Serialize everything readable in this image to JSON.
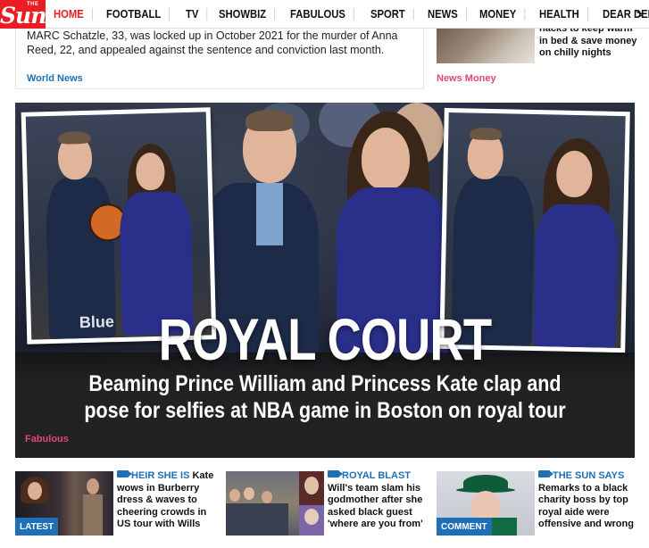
{
  "brand": {
    "logo_small": "THE",
    "logo_main": "Sun",
    "red": "#eb1c24",
    "blue": "#1e6fb5",
    "pink": "#e0457b"
  },
  "nav": {
    "items": [
      "HOME",
      "FOOTBALL",
      "TV",
      "SHOWBIZ",
      "FABULOUS",
      "SPORT",
      "NEWS",
      "MONEY",
      "HEALTH",
      "DEAR DEIRDRE"
    ],
    "active": "HOME",
    "more_icon": ">"
  },
  "top_left": {
    "text": "MARC Schatzle, 33, was locked up in October 2021 for the murder of Anna Reed, 22, and appealed against the sentence and conviction last month.",
    "category": "World News"
  },
  "top_right": {
    "text": "hacks to keep warm in bed & save money on chilly nights",
    "category": "News Money"
  },
  "hero": {
    "headline": "ROYAL COURT",
    "subheadline": "Beaming Prince William and Princess Kate clap and pose for selfies at NBA game in Boston on royal tour",
    "category": "Fabulous",
    "overlay_text": "Blue"
  },
  "cards": [
    {
      "kicker": "HEIR SHE IS",
      "text": "Kate wows in Burberry dress & waves to cheering crowds in US tour with Wills",
      "badge": "LATEST"
    },
    {
      "kicker": "ROYAL BLAST",
      "text": "Will's team slam his godmother after she asked black guest 'where are you from'",
      "badge": ""
    },
    {
      "kicker": "THE SUN SAYS",
      "text": "Remarks to a black charity boss by top royal aide were offensive and wrong",
      "badge": "COMMENT"
    }
  ]
}
